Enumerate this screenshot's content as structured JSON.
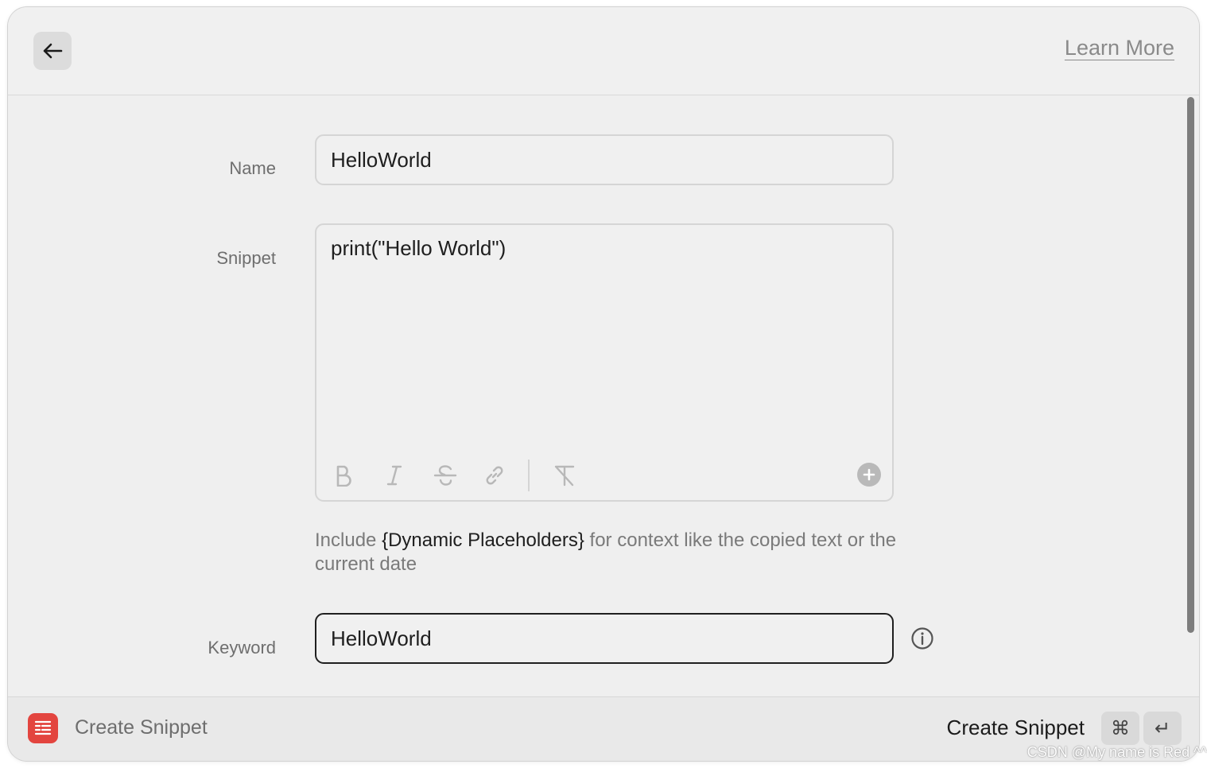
{
  "header": {
    "back_icon": "arrow-left-icon",
    "learn_more_label": "Learn More"
  },
  "form": {
    "name": {
      "label": "Name",
      "value": "HelloWorld"
    },
    "snippet": {
      "label": "Snippet",
      "value": "print(\"Hello World\")",
      "toolbar": [
        "bold-icon",
        "italic-icon",
        "strikethrough-icon",
        "link-icon",
        "clear-format-icon",
        "add-circle-icon"
      ]
    },
    "hint": {
      "prefix": "Include ",
      "strong": "{Dynamic Placeholders}",
      "suffix": " for context like the copied text or the current date"
    },
    "keyword": {
      "label": "Keyword",
      "value": "HelloWorld",
      "info_icon": "info-circle-icon"
    }
  },
  "footer": {
    "app_icon": "snippet-app-icon",
    "title": "Create Snippet",
    "action_label": "Create Snippet",
    "shortcut_keys": [
      "⌘",
      "↵"
    ]
  },
  "watermark": "CSDN @My name is Red ^^",
  "colors": {
    "window_bg": "#efefef",
    "app_icon_bg": "#e3453f",
    "focused_border": "#1f1f1f",
    "field_border": "#d5d5d5"
  }
}
